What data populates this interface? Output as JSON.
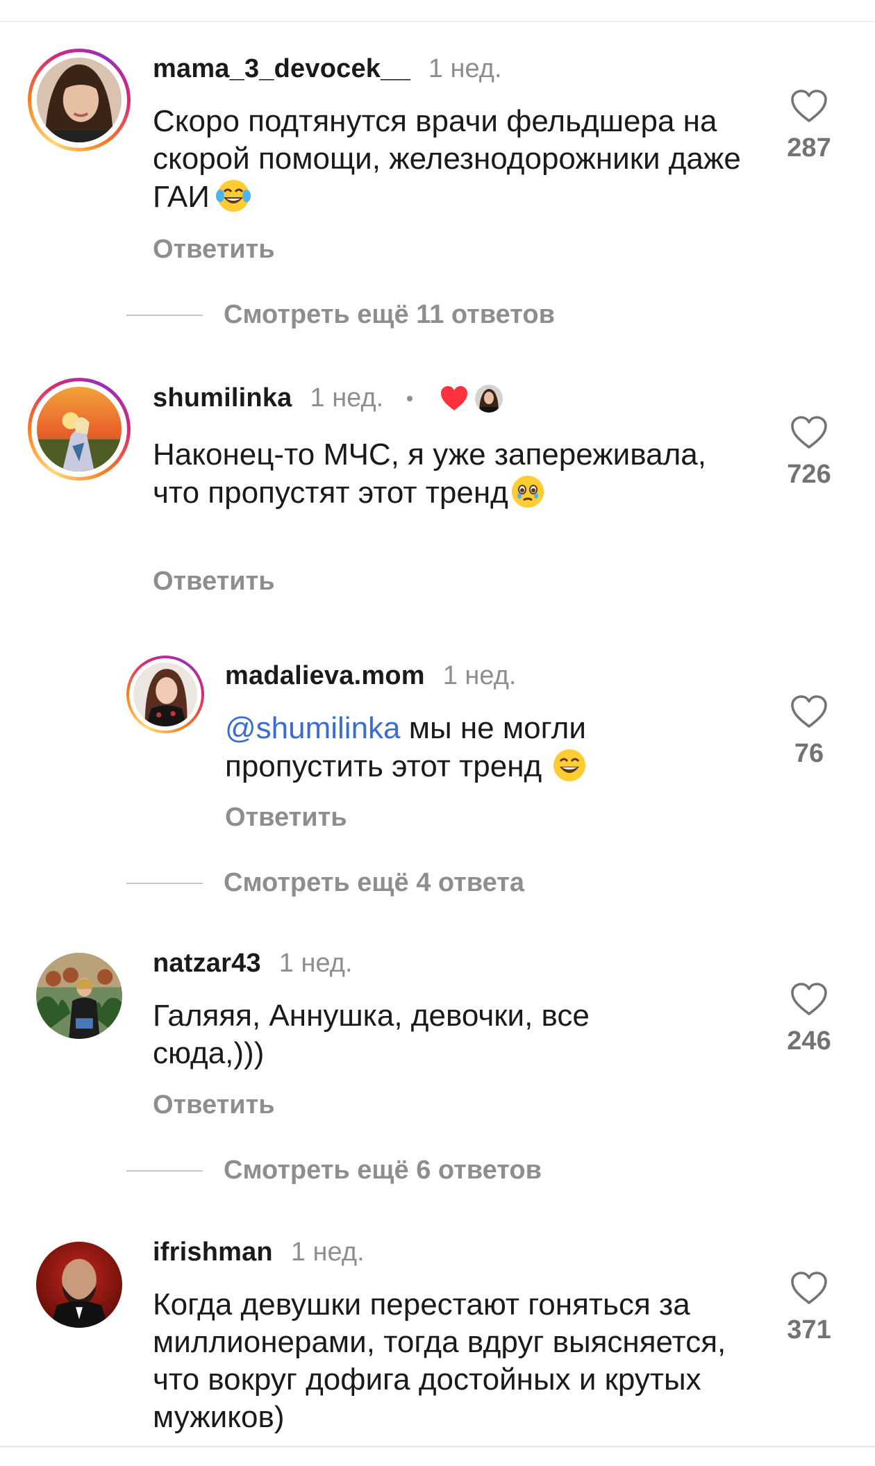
{
  "colors": {
    "text": "#1a1a1a",
    "muted": "#8e8e8e",
    "mention": "#3b6dd1",
    "liked_heart": "#ff3040"
  },
  "comments": [
    {
      "username": "mama_3_devocek__",
      "time": "1 нед.",
      "text": "Скоро подтянутся врачи фельдшера на скорой помощи, железнодорожники даже ГАИ",
      "emoji": "face-with-tears-of-joy",
      "reply_label": "Ответить",
      "likes": "287",
      "more_replies": "Смотреть ещё 11 ответов"
    },
    {
      "username": "shumilinka",
      "time": "1 нед.",
      "liked_by_author": true,
      "text": "Наконец-то МЧС, я уже запереживала, что пропустят этот тренд",
      "emoji": "face-holding-back-tears",
      "reply_label": "Ответить",
      "likes": "726"
    },
    {
      "username": "madalieva.mom",
      "time": "1 нед.",
      "mention": "@shumilinka",
      "text": "мы не могли пропустить этот тренд",
      "emoji": "grinning-face-with-smiling-eyes",
      "reply_label": "Ответить",
      "likes": "76",
      "more_replies": "Смотреть ещё 4 ответа"
    },
    {
      "username": "natzar43",
      "time": "1 нед.",
      "text": "Галяяя, Аннушка, девочки, все сюда,)))",
      "reply_label": "Ответить",
      "likes": "246",
      "more_replies": "Смотреть ещё 6 ответов"
    },
    {
      "username": "ifrishman",
      "time": "1 нед.",
      "text": "Когда девушки перестают гоняться за миллионерами, тогда вдруг выясняется, что вокруг дофига достойных и крутых мужиков)",
      "likes": "371"
    }
  ]
}
